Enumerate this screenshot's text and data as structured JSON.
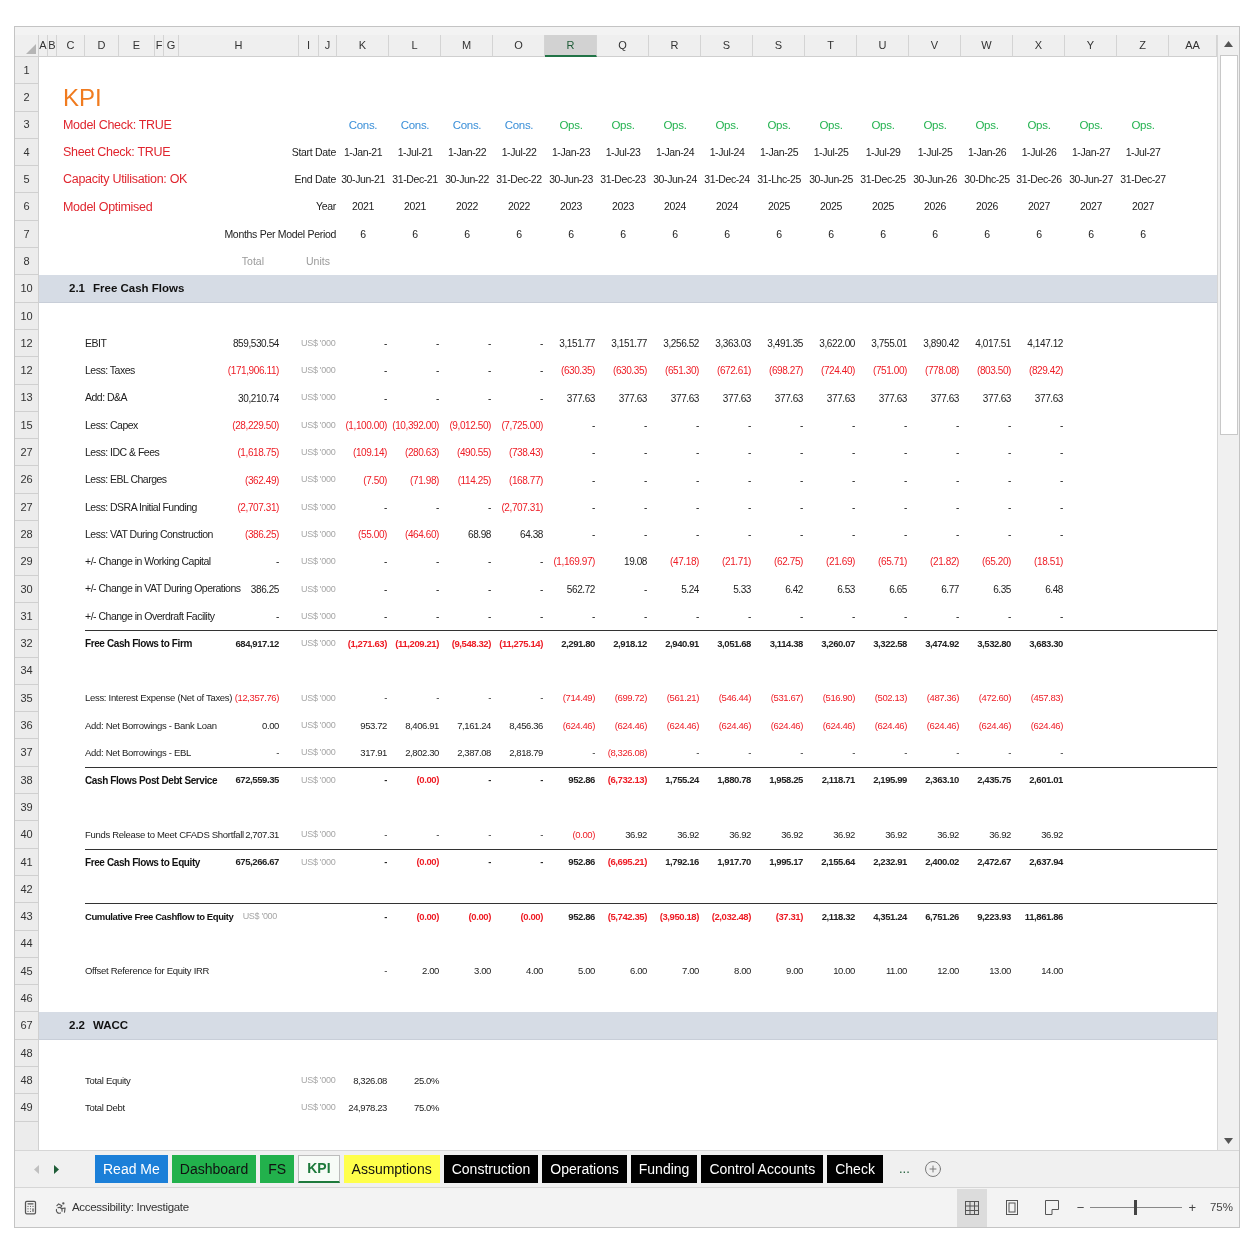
{
  "sheet": {
    "columns": [
      {
        "label": "A",
        "selected": false
      },
      {
        "label": "B",
        "selected": false
      },
      {
        "label": "C",
        "selected": false
      },
      {
        "label": "D",
        "selected": false
      },
      {
        "label": "E",
        "selected": false
      },
      {
        "label": "F",
        "selected": false
      },
      {
        "label": "G",
        "selected": false
      },
      {
        "label": "H",
        "selected": false
      },
      {
        "label": "I",
        "selected": false
      },
      {
        "label": "J",
        "selected": false
      },
      {
        "label": "K",
        "selected": false
      },
      {
        "label": "L",
        "selected": false
      },
      {
        "label": "M",
        "selected": false
      },
      {
        "label": "O",
        "selected": false
      },
      {
        "label": "R",
        "selected": true
      },
      {
        "label": "Q",
        "selected": false
      },
      {
        "label": "R",
        "selected": false
      },
      {
        "label": "S",
        "selected": false
      },
      {
        "label": "S",
        "selected": false
      },
      {
        "label": "T",
        "selected": false
      },
      {
        "label": "U",
        "selected": false
      },
      {
        "label": "V",
        "selected": false
      },
      {
        "label": "W",
        "selected": false
      },
      {
        "label": "X",
        "selected": false
      },
      {
        "label": "Y",
        "selected": false
      },
      {
        "label": "Z",
        "selected": false
      },
      {
        "label": "AA",
        "selected": false
      }
    ],
    "rows": [
      {
        "row": "1",
        "kind": "blank"
      },
      {
        "row": "2",
        "kind": "title",
        "text": "KPI"
      },
      {
        "row": "3",
        "kind": "phases",
        "status": "Model Check: TRUE",
        "phases": [
          {
            "text": "Cons.",
            "color": "#3a8fd8"
          },
          {
            "text": "Cons.",
            "color": "#3a8fd8"
          },
          {
            "text": "Cons.",
            "color": "#3a8fd8"
          },
          {
            "text": "Cons.",
            "color": "#3a8fd8"
          },
          {
            "text": "Ops.",
            "color": "#22b24f"
          },
          {
            "text": "Ops.",
            "color": "#22b24f"
          },
          {
            "text": "Ops.",
            "color": "#22b24f"
          },
          {
            "text": "Ops.",
            "color": "#22b24f"
          },
          {
            "text": "Ops.",
            "color": "#22b24f"
          },
          {
            "text": "Ops.",
            "color": "#22b24f"
          },
          {
            "text": "Ops.",
            "color": "#22b24f"
          },
          {
            "text": "Ops.",
            "color": "#22b24f"
          },
          {
            "text": "Ops.",
            "color": "#22b24f"
          },
          {
            "text": "Ops.",
            "color": "#22b24f"
          },
          {
            "text": "Ops.",
            "color": "#22b24f"
          },
          {
            "text": "Ops.",
            "color": "#22b24f"
          }
        ]
      },
      {
        "row": "4",
        "kind": "periods",
        "status": "Sheet Check: TRUE",
        "caption": "Start Date",
        "cells": [
          "1-Jan-21",
          "1-Jul-21",
          "1-Jan-22",
          "1-Jul-22",
          "1-Jan-23",
          "1-Jul-23",
          "1-Jan-24",
          "1-Jul-24",
          "1-Jan-25",
          "1-Jul-25",
          "1-Jul-29",
          "1-Jul-25",
          "1-Jan-26",
          "1-Jul-26",
          "1-Jan-27",
          "1-Jul-27"
        ]
      },
      {
        "row": "5",
        "kind": "periods",
        "status": "Capacity Utilisation: OK",
        "caption": "End Date",
        "cells": [
          "30-Jun-21",
          "31-Dec-21",
          "30-Jun-22",
          "31-Dec-22",
          "30-Jun-23",
          "31-Dec-23",
          "30-Jun-24",
          "31-Dec-24",
          "31-Lhc-25",
          "30-Jun-25",
          "31-Dec-25",
          "30-Jun-26",
          "30-Dhc-25",
          "31-Dec-26",
          "30-Jun-27",
          "31-Dec-27"
        ]
      },
      {
        "row": "6",
        "kind": "periods",
        "status": "Model Optimised",
        "caption": "Year",
        "cells": [
          "2021",
          "2021",
          "2022",
          "2022",
          "2023",
          "2023",
          "2024",
          "2024",
          "2025",
          "2025",
          "2025",
          "2026",
          "2026",
          "2027",
          "2027",
          "2027"
        ]
      },
      {
        "row": "7",
        "kind": "periods",
        "caption": "Months Per Model Period",
        "cells": [
          "6",
          "6",
          "6",
          "6",
          "6",
          "6",
          "6",
          "6",
          "6",
          "6",
          "6",
          "6",
          "6",
          "6",
          "6",
          "6"
        ]
      },
      {
        "row": "8",
        "kind": "captions",
        "total": "Total",
        "units": "Units"
      },
      {
        "row": "10",
        "kind": "section",
        "number": "2.1",
        "title": "Free Cash Flows"
      },
      {
        "row": "10",
        "kind": "blank"
      },
      {
        "row": "12",
        "kind": "line",
        "label": "EBIT",
        "total": "859,530.54",
        "total_red": false,
        "units": "US$ '000",
        "cells": [
          "-",
          "-",
          "-",
          "-",
          "3,151.77",
          "3,151.77",
          "3,256.52",
          "3,363.03",
          "3,491.35",
          "3,622.00",
          "3,755.01",
          "3,890.42",
          "4,017.51",
          "4,147.12"
        ],
        "red": [
          false,
          false,
          false,
          false,
          false,
          false,
          false,
          false,
          false,
          false,
          false,
          false,
          false,
          false
        ]
      },
      {
        "row": "12",
        "kind": "line",
        "label": "Less: Taxes",
        "total": "(171,906.11)",
        "total_red": true,
        "units": "US$ '000",
        "cells": [
          "-",
          "-",
          "-",
          "-",
          "(630.35)",
          "(630.35)",
          "(651.30)",
          "(672.61)",
          "(698.27)",
          "(724.40)",
          "(751.00)",
          "(778.08)",
          "(803.50)",
          "(829.42)"
        ],
        "red": [
          false,
          false,
          false,
          false,
          true,
          true,
          true,
          true,
          true,
          true,
          true,
          true,
          true,
          true
        ]
      },
      {
        "row": "13",
        "kind": "line",
        "label": "Add: D&A",
        "total": "30,210.74",
        "total_red": false,
        "units": "US$ '000",
        "cells": [
          "-",
          "-",
          "-",
          "-",
          "377.63",
          "377.63",
          "377.63",
          "377.63",
          "377.63",
          "377.63",
          "377.63",
          "377.63",
          "377.63",
          "377.63"
        ],
        "red": [
          false,
          false,
          false,
          false,
          false,
          false,
          false,
          false,
          false,
          false,
          false,
          false,
          false,
          false
        ]
      },
      {
        "row": "15",
        "kind": "line",
        "label": "Less: Capex",
        "total": "(28,229.50)",
        "total_red": true,
        "units": "US$ '000",
        "cells": [
          "(1,100.00)",
          "(10,392.00)",
          "(9,012.50)",
          "(7,725.00)",
          "-",
          "-",
          "-",
          "-",
          "-",
          "-",
          "-",
          "-",
          "-",
          "-"
        ],
        "red": [
          true,
          true,
          true,
          true,
          false,
          false,
          false,
          false,
          false,
          false,
          false,
          false,
          false,
          false
        ]
      },
      {
        "row": "27",
        "kind": "line",
        "label": "Less: IDC & Fees",
        "total": "(1,618.75)",
        "total_red": true,
        "units": "US$ '000",
        "cells": [
          "(109.14)",
          "(280.63)",
          "(490.55)",
          "(738.43)",
          "-",
          "-",
          "-",
          "-",
          "-",
          "-",
          "-",
          "-",
          "-",
          "-"
        ],
        "red": [
          true,
          true,
          true,
          true,
          false,
          false,
          false,
          false,
          false,
          false,
          false,
          false,
          false,
          false
        ]
      },
      {
        "row": "26",
        "kind": "line",
        "label": "Less: EBL Charges",
        "total": "(362.49)",
        "total_red": true,
        "units": "US$ '000",
        "cells": [
          "(7.50)",
          "(71.98)",
          "(114.25)",
          "(168.77)",
          "-",
          "-",
          "-",
          "-",
          "-",
          "-",
          "-",
          "-",
          "-",
          "-"
        ],
        "red": [
          true,
          true,
          true,
          true,
          false,
          false,
          false,
          false,
          false,
          false,
          false,
          false,
          false,
          false
        ]
      },
      {
        "row": "27",
        "kind": "line",
        "label": "Less: DSRA Initial Funding",
        "total": "(2,707.31)",
        "total_red": true,
        "units": "US$ '000",
        "cells": [
          "-",
          "-",
          "-",
          "(2,707.31)",
          "-",
          "-",
          "-",
          "-",
          "-",
          "-",
          "-",
          "-",
          "-",
          "-"
        ],
        "red": [
          false,
          false,
          false,
          true,
          false,
          false,
          false,
          false,
          false,
          false,
          false,
          false,
          false,
          false
        ]
      },
      {
        "row": "28",
        "kind": "line",
        "label": "Less: VAT During Construction",
        "total": "(386.25)",
        "total_red": true,
        "units": "US$ '000",
        "cells": [
          "(55.00)",
          "(464.60)",
          "68.98",
          "64.38",
          "-",
          "-",
          "-",
          "-",
          "-",
          "-",
          "-",
          "-",
          "-",
          "-"
        ],
        "red": [
          true,
          true,
          false,
          false,
          false,
          false,
          false,
          false,
          false,
          false,
          false,
          false,
          false,
          false
        ]
      },
      {
        "row": "29",
        "kind": "line",
        "label": "+/- Change in Working Capital",
        "total": "-",
        "total_red": false,
        "units": "US$ '000",
        "cells": [
          "-",
          "-",
          "-",
          "-",
          "(1,169.97)",
          "19.08",
          "(47.18)",
          "(21.71)",
          "(62.75)",
          "(21.69)",
          "(65.71)",
          "(21.82)",
          "(65.20)",
          "(18.51)"
        ],
        "red": [
          false,
          false,
          false,
          false,
          true,
          false,
          true,
          true,
          true,
          true,
          true,
          true,
          true,
          true
        ]
      },
      {
        "row": "30",
        "kind": "line",
        "label": "+/- Change in VAT During Operations",
        "total": "386.25",
        "total_red": false,
        "units": "US$ '000",
        "cells": [
          "-",
          "-",
          "-",
          "-",
          "562.72",
          "-",
          "5.24",
          "5.33",
          "6.42",
          "6.53",
          "6.65",
          "6.77",
          "6.35",
          "6.48"
        ],
        "red": [
          false,
          false,
          false,
          false,
          false,
          false,
          false,
          false,
          false,
          false,
          false,
          false,
          false,
          false
        ]
      },
      {
        "row": "31",
        "kind": "line",
        "label": "+/- Change in Overdraft Facility",
        "total": "-",
        "total_red": false,
        "units": "US$ '000",
        "cells": [
          "-",
          "-",
          "-",
          "-",
          "-",
          "-",
          "-",
          "-",
          "-",
          "-",
          "-",
          "-",
          "-",
          "-"
        ],
        "red": [
          false,
          false,
          false,
          false,
          false,
          false,
          false,
          false,
          false,
          false,
          false,
          false,
          false,
          false
        ]
      },
      {
        "row": "32",
        "kind": "subtotal",
        "label": "Free Cash Flows to Firm",
        "total": "684,917.12",
        "total_red": false,
        "units": "US$ '000",
        "cells": [
          "(1,271.63)",
          "(11,209.21)",
          "(9,548.32)",
          "(11,275.14)",
          "2,291.80",
          "2,918.12",
          "2,940.91",
          "3,051.68",
          "3,114.38",
          "3,260.07",
          "3,322.58",
          "3,474.92",
          "3,532.80",
          "3,683.30"
        ],
        "red": [
          true,
          true,
          true,
          true,
          false,
          false,
          false,
          false,
          false,
          false,
          false,
          false,
          false,
          false
        ]
      },
      {
        "row": "34",
        "kind": "blank"
      },
      {
        "row": "35",
        "kind": "detail",
        "label": "Less: Interest Expense (Net of Taxes)",
        "total": "(12,357.76)",
        "total_red": true,
        "units": "US$ '000",
        "cells": [
          "-",
          "-",
          "-",
          "-",
          "(714.49)",
          "(699.72)",
          "(561.21)",
          "(546.44)",
          "(531.67)",
          "(516.90)",
          "(502.13)",
          "(487.36)",
          "(472.60)",
          "(457.83)"
        ],
        "red": [
          false,
          false,
          false,
          false,
          true,
          true,
          true,
          true,
          true,
          true,
          true,
          true,
          true,
          true
        ]
      },
      {
        "row": "36",
        "kind": "detail",
        "label": "Add: Net Borrowings - Bank Loan",
        "total": "0.00",
        "total_red": false,
        "units": "US$ '000",
        "cells": [
          "953.72",
          "8,406.91",
          "7,161.24",
          "8,456.36",
          "(624.46)",
          "(624.46)",
          "(624.46)",
          "(624.46)",
          "(624.46)",
          "(624.46)",
          "(624.46)",
          "(624.46)",
          "(624.46)",
          "(624.46)"
        ],
        "red": [
          false,
          false,
          false,
          false,
          true,
          true,
          true,
          true,
          true,
          true,
          true,
          true,
          true,
          true
        ]
      },
      {
        "row": "37",
        "kind": "detail",
        "label": "Add: Net Borrowings - EBL",
        "total": "-",
        "total_red": false,
        "units": "US$ '000",
        "cells": [
          "317.91",
          "2,802.30",
          "2,387.08",
          "2,818.79",
          "-",
          "(8,326.08)",
          "-",
          "-",
          "-",
          "-",
          "-",
          "-",
          "-",
          "-"
        ],
        "red": [
          false,
          false,
          false,
          false,
          false,
          true,
          false,
          false,
          false,
          false,
          false,
          false,
          false,
          false
        ]
      },
      {
        "row": "38",
        "kind": "subtotal",
        "label": "Cash Flows Post Debt Service",
        "total": "672,559.35",
        "total_red": false,
        "units": "US$ '000",
        "cells": [
          "-",
          "(0.00)",
          "-",
          "-",
          "952.86",
          "(6,732.13)",
          "1,755.24",
          "1,880.78",
          "1,958.25",
          "2,118.71",
          "2,195.99",
          "2,363.10",
          "2,435.75",
          "2,601.01"
        ],
        "red": [
          false,
          true,
          false,
          false,
          false,
          true,
          false,
          false,
          false,
          false,
          false,
          false,
          false,
          false
        ]
      },
      {
        "row": "39",
        "kind": "blank"
      },
      {
        "row": "40",
        "kind": "detail",
        "label": "Funds Release to Meet CFADS Shortfall",
        "total": "2,707.31",
        "total_red": false,
        "units": "US$ '000",
        "cells": [
          "-",
          "-",
          "-",
          "-",
          "(0.00)",
          "36.92",
          "36.92",
          "36.92",
          "36.92",
          "36.92",
          "36.92",
          "36.92",
          "36.92",
          "36.92"
        ],
        "red": [
          false,
          false,
          false,
          false,
          true,
          false,
          false,
          false,
          false,
          false,
          false,
          false,
          false,
          false
        ]
      },
      {
        "row": "41",
        "kind": "subtotal",
        "label": "Free Cash Flows to Equity",
        "total": "675,266.67",
        "total_red": false,
        "units": "US$ '000",
        "cells": [
          "-",
          "(0.00)",
          "-",
          "-",
          "952.86",
          "(6,695.21)",
          "1,792.16",
          "1,917.70",
          "1,995.17",
          "2,155.64",
          "2,232.91",
          "2,400.02",
          "2,472.67",
          "2,637.94"
        ],
        "red": [
          false,
          true,
          false,
          false,
          false,
          true,
          false,
          false,
          false,
          false,
          false,
          false,
          false,
          false
        ]
      },
      {
        "row": "42",
        "kind": "blank"
      },
      {
        "row": "43",
        "kind": "cumulative",
        "label": "Cumulative Free Cashflow to Equity",
        "total": "US$ '000",
        "cells": [
          "-",
          "(0.00)",
          "(0.00)",
          "(0.00)",
          "952.86",
          "(5,742.35)",
          "(3,950.18)",
          "(2,032.48)",
          "(37.31)",
          "2,118.32",
          "4,351.24",
          "6,751.26",
          "9,223.93",
          "11,861.86"
        ],
        "red": [
          false,
          true,
          true,
          true,
          false,
          true,
          true,
          true,
          true,
          false,
          false,
          false,
          false,
          false
        ]
      },
      {
        "row": "44",
        "kind": "blank"
      },
      {
        "row": "45",
        "kind": "detail",
        "label": "Offset Reference for Equity IRR",
        "cells": [
          "-",
          "2.00",
          "3.00",
          "4.00",
          "5.00",
          "6.00",
          "7.00",
          "8.00",
          "9.00",
          "10.00",
          "11.00",
          "12.00",
          "13.00",
          "14.00"
        ],
        "red": [
          false,
          false,
          false,
          false,
          false,
          false,
          false,
          false,
          false,
          false,
          false,
          false,
          false,
          false
        ]
      },
      {
        "row": "46",
        "kind": "blank"
      },
      {
        "row": "67",
        "kind": "section",
        "number": "2.2",
        "title": "WACC"
      },
      {
        "row": "48",
        "kind": "blank"
      },
      {
        "row": "48",
        "kind": "detail",
        "label": "Total Equity",
        "units": "US$ '000",
        "cells": [
          "8,326.08",
          "25.0%"
        ],
        "red": [
          false,
          false
        ]
      },
      {
        "row": "49",
        "kind": "detail",
        "label": "Total Debt",
        "units": "US$ '000",
        "cells": [
          "24,978.23",
          "75.0%"
        ],
        "red": [
          false,
          false
        ]
      }
    ]
  },
  "tabs": [
    {
      "label": "Read Me",
      "color": "#1b7fd8",
      "selected": false
    },
    {
      "label": "Dashboard",
      "color": "#22b14c",
      "selected": false
    },
    {
      "label": "FS",
      "color": "#22b14c",
      "selected": false
    },
    {
      "label": "KPI",
      "color": "#1e7a3c",
      "selected": true
    },
    {
      "label": "Assumptions",
      "color": "#ffff4a",
      "selected": false
    },
    {
      "label": "Construction",
      "color": "#000000",
      "selected": false
    },
    {
      "label": "Operations",
      "color": "#000000",
      "selected": false
    },
    {
      "label": "Funding",
      "color": "#000000",
      "selected": false
    },
    {
      "label": "Control Accounts",
      "color": "#000000",
      "selected": false
    },
    {
      "label": "Check",
      "color": "#000000",
      "selected": false
    }
  ],
  "tab_overflow": "...",
  "status_bar": {
    "accessibility": "Accessibility: Investigate",
    "views": [
      {
        "kind": "normal",
        "selected": true
      },
      {
        "kind": "page_layout",
        "selected": false
      },
      {
        "kind": "page_break",
        "selected": false
      }
    ],
    "zoom": {
      "minus": "−",
      "plus": "+",
      "level": 0.47,
      "reading": "75%"
    }
  }
}
